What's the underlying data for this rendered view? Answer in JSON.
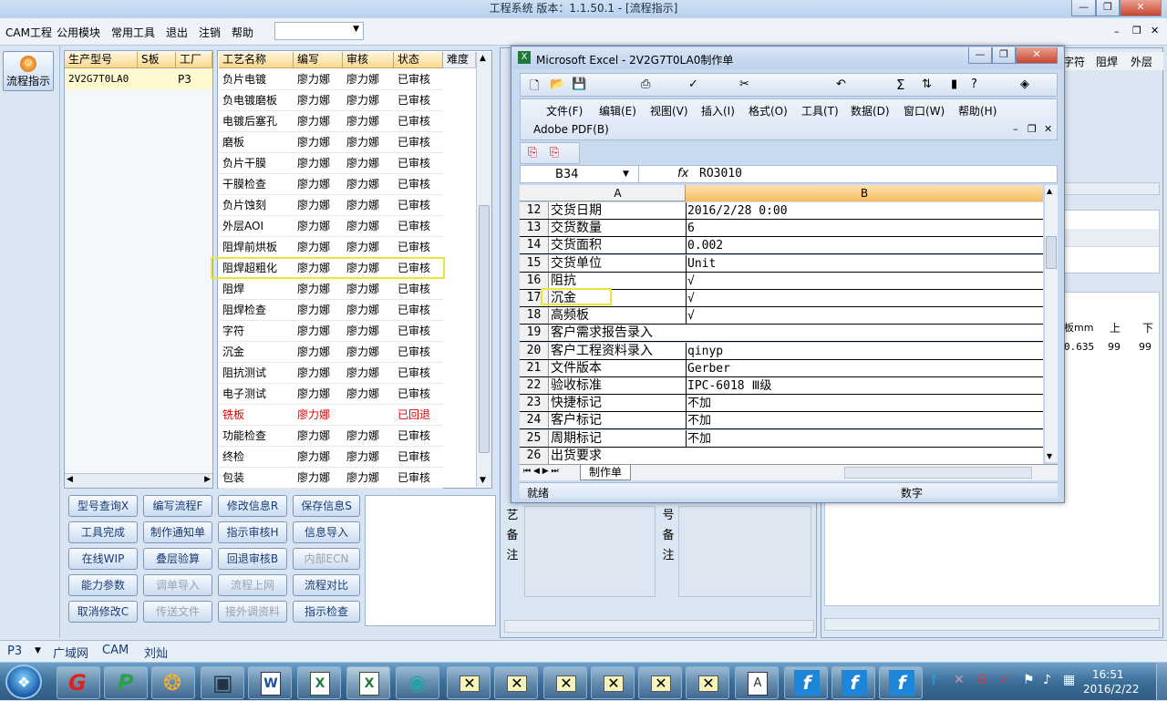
{
  "window": {
    "title": "工程系统   版本：1.1.50.1 - [流程指示]"
  },
  "menu": {
    "items": [
      "CAM工程",
      "公用模块",
      "常用工具",
      "退出",
      "注销",
      "帮助"
    ]
  },
  "nav": {
    "button_label": "流程指示"
  },
  "products": {
    "headers": [
      "生产型号",
      "S板",
      "工厂"
    ],
    "rows": [
      [
        "2V2G7T0LA0",
        "",
        "P3"
      ]
    ]
  },
  "process": {
    "headers": [
      "工艺名称",
      "编写",
      "审核",
      "状态",
      "难度"
    ],
    "rows": [
      [
        "负片电镀",
        "廖力娜",
        "廖力娜",
        "已审核"
      ],
      [
        "负电镀磨板",
        "廖力娜",
        "廖力娜",
        "已审核"
      ],
      [
        "电镀后塞孔",
        "廖力娜",
        "廖力娜",
        "已审核"
      ],
      [
        "磨板",
        "廖力娜",
        "廖力娜",
        "已审核"
      ],
      [
        "负片干膜",
        "廖力娜",
        "廖力娜",
        "已审核"
      ],
      [
        "干膜检查",
        "廖力娜",
        "廖力娜",
        "已审核"
      ],
      [
        "负片蚀刻",
        "廖力娜",
        "廖力娜",
        "已审核"
      ],
      [
        "外层AOI",
        "廖力娜",
        "廖力娜",
        "已审核"
      ],
      [
        "阻焊前烘板",
        "廖力娜",
        "廖力娜",
        "已审核"
      ],
      [
        "阻焊超粗化",
        "廖力娜",
        "廖力娜",
        "已审核"
      ],
      [
        "阻焊",
        "廖力娜",
        "廖力娜",
        "已审核"
      ],
      [
        "阻焊检查",
        "廖力娜",
        "廖力娜",
        "已审核"
      ],
      [
        "字符",
        "廖力娜",
        "廖力娜",
        "已审核"
      ],
      [
        "沉金",
        "廖力娜",
        "廖力娜",
        "已审核"
      ],
      [
        "阻抗测试",
        "廖力娜",
        "廖力娜",
        "已审核"
      ],
      [
        "电子测试",
        "廖力娜",
        "廖力娜",
        "已审核"
      ],
      [
        "铣板",
        "廖力娜",
        "",
        "已回退"
      ],
      [
        "功能检查",
        "廖力娜",
        "廖力娜",
        "已审核"
      ],
      [
        "终检",
        "廖力娜",
        "廖力娜",
        "已审核"
      ],
      [
        "包装",
        "廖力娜",
        "廖力娜",
        "已审核"
      ]
    ]
  },
  "actions": [
    [
      "型号查询X",
      "编写流程F",
      "修改信息R",
      "保存信息S"
    ],
    [
      "工具完成",
      "制作通知单",
      "指示审核H",
      "信息导入"
    ],
    [
      "在线WIP",
      "叠层验算",
      "回退审核B",
      "内部ECN"
    ],
    [
      "能力参数",
      "调单导入",
      "流程上网",
      "流程对比"
    ],
    [
      "取消修改C",
      "传送文件",
      "接外调资料",
      "指示检查"
    ]
  ],
  "mid_right": {
    "col1_label": "艺备注",
    "col2_label": "号备注",
    "top_cols": [
      "字符",
      "阻焊",
      "外层"
    ],
    "table_headers": [
      "板mm",
      "上",
      "下"
    ],
    "table_row": [
      "0.635",
      "99",
      "99"
    ]
  },
  "excel": {
    "title": "Microsoft Excel - 2V2G7T0LA0制作单",
    "menu": [
      "文件(F)",
      "编辑(E)",
      "视图(V)",
      "插入(I)",
      "格式(O)",
      "工具(T)",
      "数据(D)",
      "窗口(W)",
      "帮助(H)"
    ],
    "menu2": "Adobe PDF(B)",
    "name_box": "B34",
    "formula": "RO3010",
    "col_a": "A",
    "col_b": "B",
    "rows": [
      [
        "12",
        "交货日期",
        "2016/2/28 0:00"
      ],
      [
        "13",
        "交货数量",
        "6"
      ],
      [
        "14",
        "交货面积",
        "0.002"
      ],
      [
        "15",
        "交货单位",
        "Unit"
      ],
      [
        "16",
        "阻抗",
        "√"
      ],
      [
        "17",
        "沉金",
        "√"
      ],
      [
        "18",
        "高频板",
        "√"
      ],
      [
        "19",
        "客户需求报告录入",
        ""
      ],
      [
        "20",
        "客户工程资料录入",
        "qinyp"
      ],
      [
        "21",
        "文件版本",
        "Gerber"
      ],
      [
        "22",
        "验收标准",
        "IPC-6018 Ⅲ级"
      ],
      [
        "23",
        "快捷标记",
        "不加"
      ],
      [
        "24",
        "客户标记",
        "不加"
      ],
      [
        "25",
        "周期标记",
        "不加"
      ],
      [
        "26",
        "出货要求",
        ""
      ]
    ],
    "sheet_tab": "制作单",
    "status": "就绪",
    "status_right": "数字"
  },
  "statusbar": {
    "factory": "P3",
    "items": [
      "广域网",
      "CAM",
      "刘灿"
    ]
  },
  "taskbar": {
    "time": "16:51",
    "date": "2016/2/22"
  },
  "colors": {
    "highlight": "#f0f000",
    "header": "#f9d88e",
    "accent": "#2f5b83"
  }
}
